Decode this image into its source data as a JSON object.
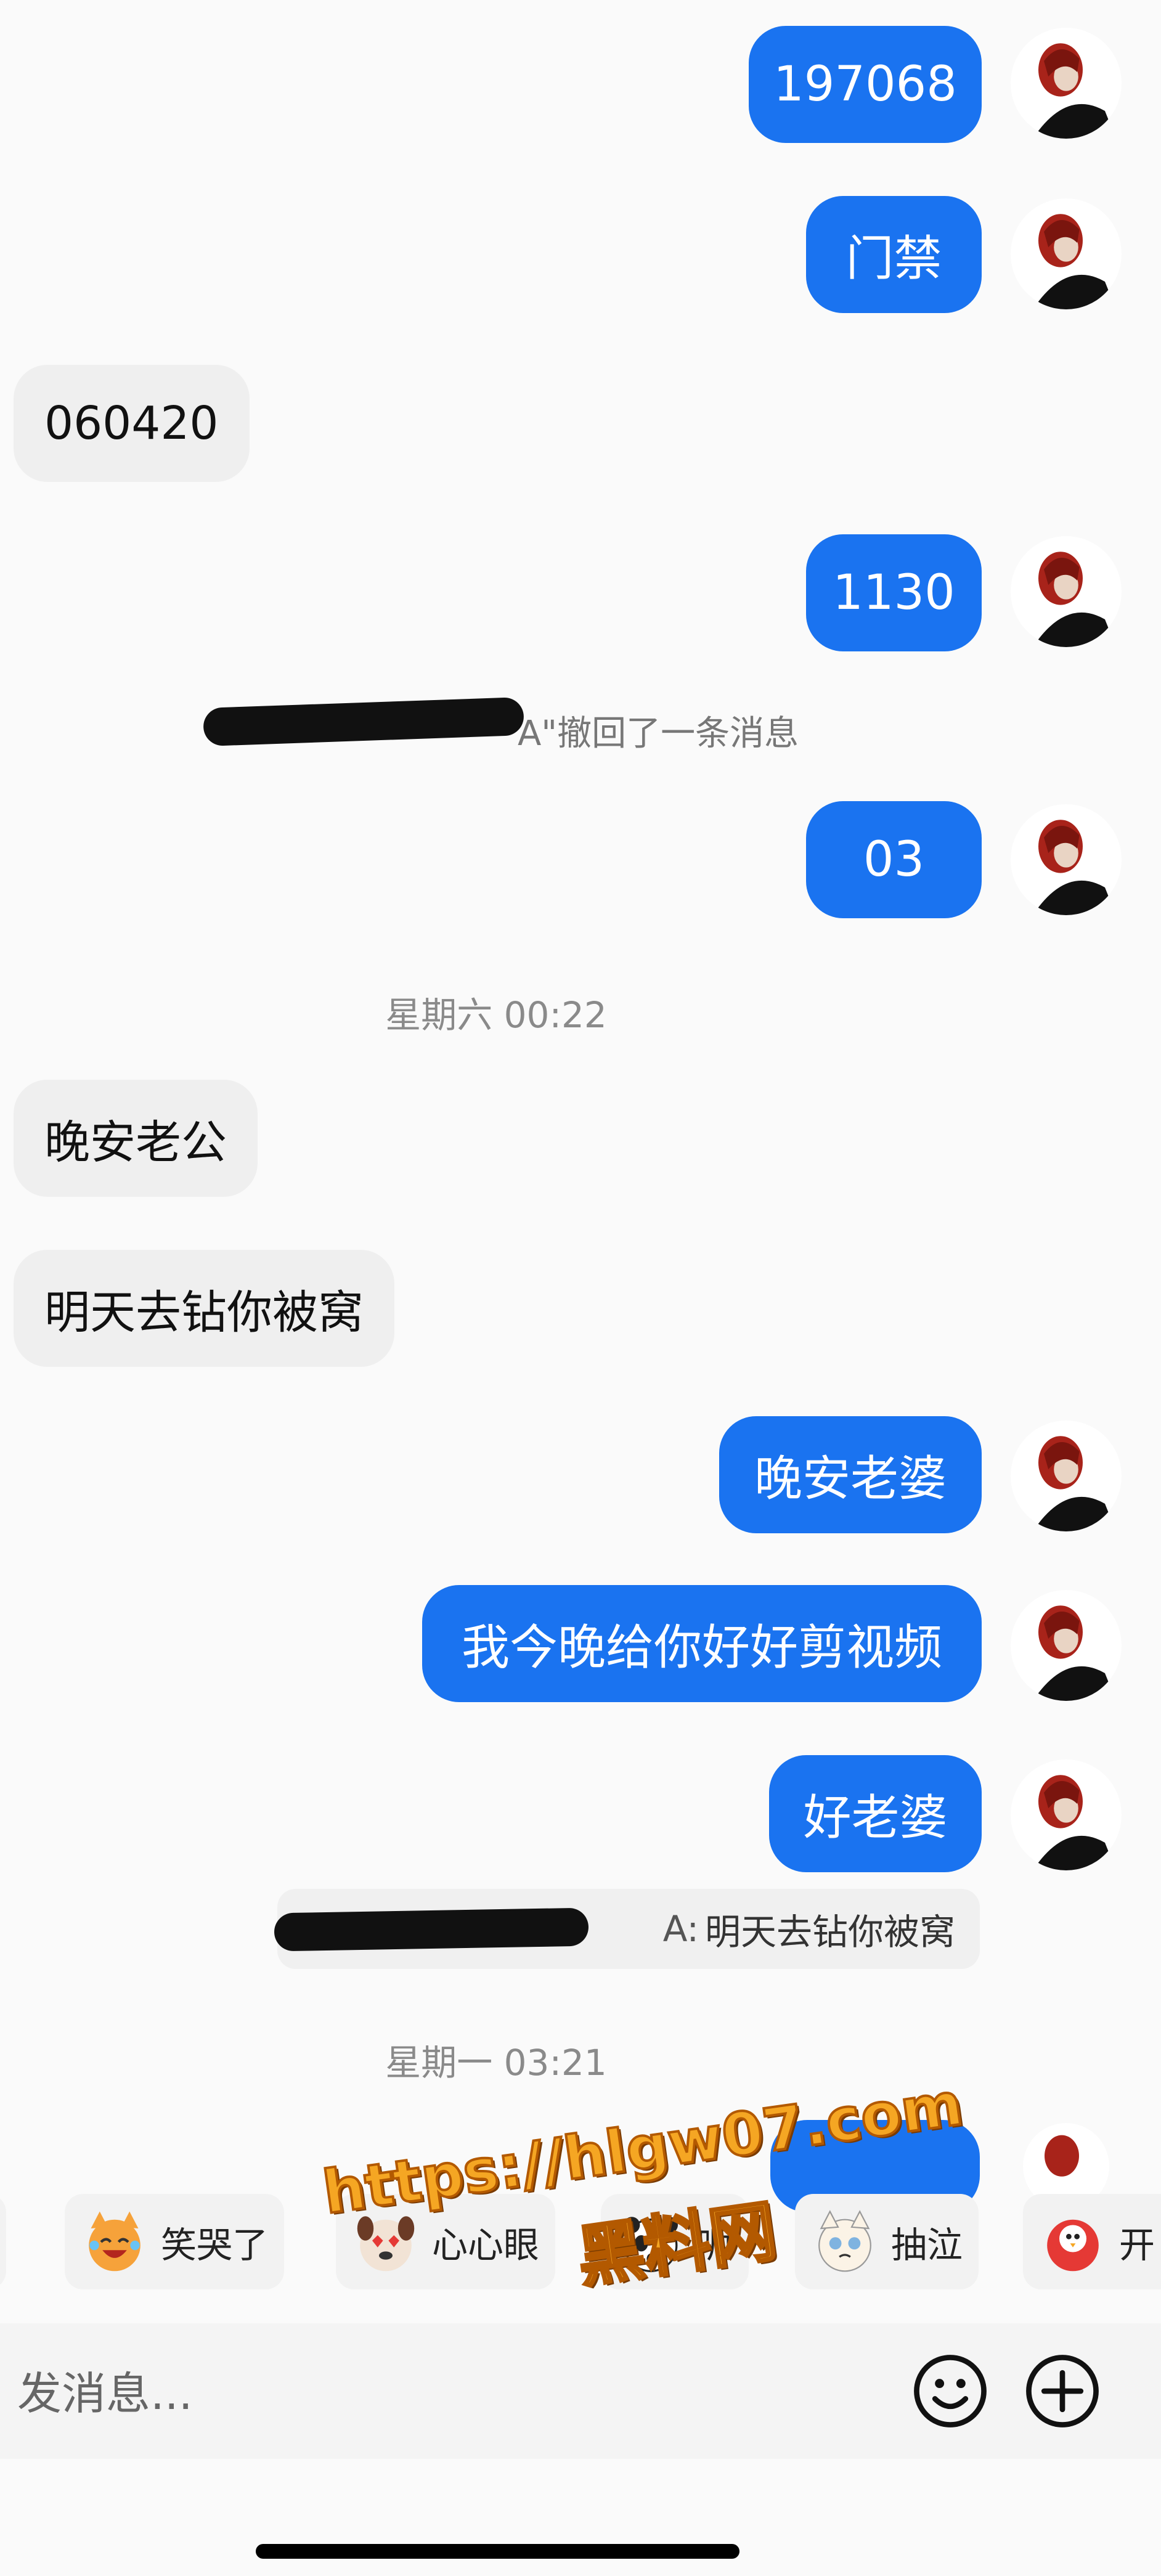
{
  "messages": {
    "out_1": "197068",
    "out_2": "门禁",
    "in_1": "060420",
    "out_3": "1130",
    "system_recall_suffix": "A\"撤回了一条消息",
    "out_4": "03",
    "time_1": "星期六 00:22",
    "in_2": "晚安老公",
    "in_3": "明天去钻你被窝",
    "out_5": "晚安老婆",
    "out_6": "我今晚给你好好剪视频",
    "out_7": "好老婆",
    "quote_text": "明天去钻你被窝",
    "quote_sep": "A:",
    "time_2": "星期一 03:21"
  },
  "stickers": [
    {
      "label": "笑哭了",
      "icon": "laughing-crying-cat-icon"
    },
    {
      "label": "心心眼",
      "icon": "heart-eyes-dog-icon"
    },
    {
      "label": "呃",
      "icon": "shocked-panda-icon"
    },
    {
      "label": "抽泣",
      "icon": "sobbing-cat-icon"
    },
    {
      "label": "开",
      "icon": "red-bird-icon"
    }
  ],
  "input": {
    "placeholder": "发消息..."
  },
  "watermark": {
    "line1": "https://hlgw07.com",
    "line2": "黑料网"
  },
  "colors": {
    "outgoing_bubble": "#1a73f0",
    "incoming_bubble": "#efefef",
    "background": "#fafafa",
    "watermark": "#f5a623"
  }
}
